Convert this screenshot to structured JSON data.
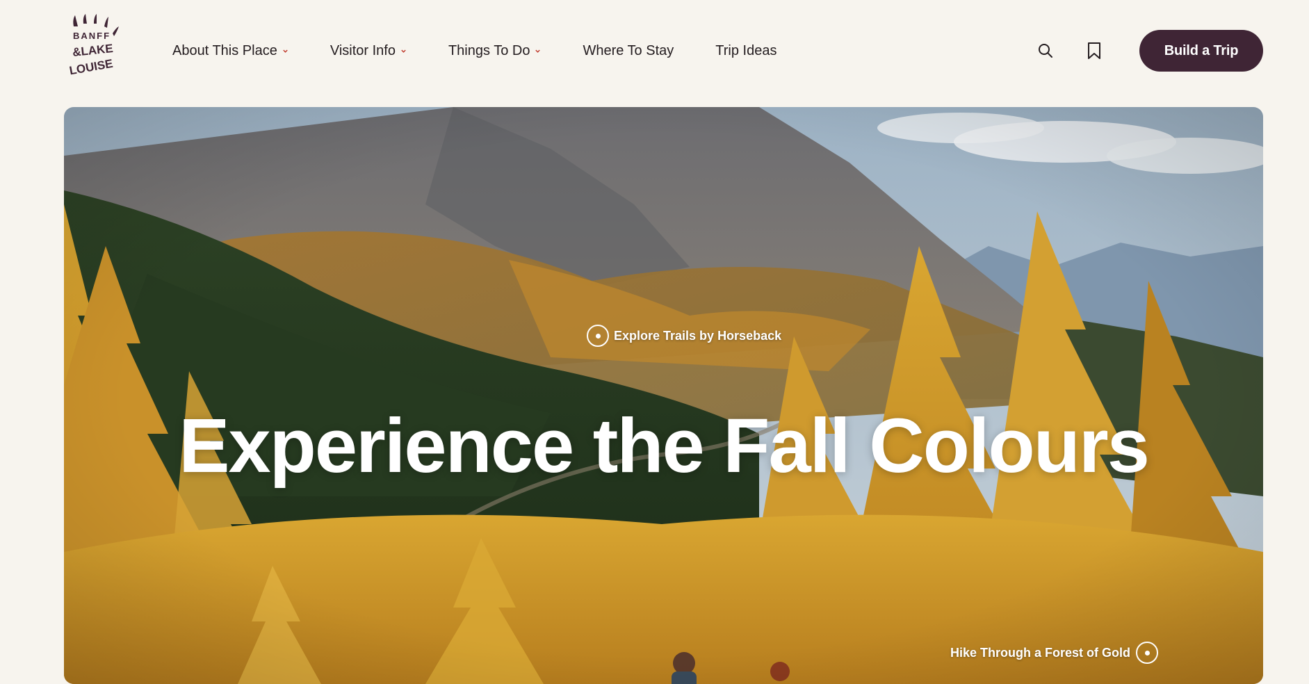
{
  "site": {
    "logo_alt": "Banff & Lake Louise",
    "colors": {
      "background": "#f7f4ee",
      "brand": "#3f2535",
      "text": "#231c1f",
      "chevron": "#c0392b"
    }
  },
  "nav": {
    "items": [
      {
        "label": "About This Place",
        "has_dropdown": true
      },
      {
        "label": "Visitor Info",
        "has_dropdown": true
      },
      {
        "label": "Things To Do",
        "has_dropdown": true
      },
      {
        "label": "Where To Stay",
        "has_dropdown": false
      },
      {
        "label": "Trip Ideas",
        "has_dropdown": false
      }
    ]
  },
  "header_actions": {
    "search_icon": "search-icon",
    "bookmark_icon": "bookmark-icon",
    "cta_label": "Build a Trip"
  },
  "hero": {
    "title": "Experience the Fall Colours",
    "hotspots": [
      {
        "label": "Explore Trails by Horseback"
      },
      {
        "label": "Hike Through a Forest of Gold"
      }
    ]
  }
}
